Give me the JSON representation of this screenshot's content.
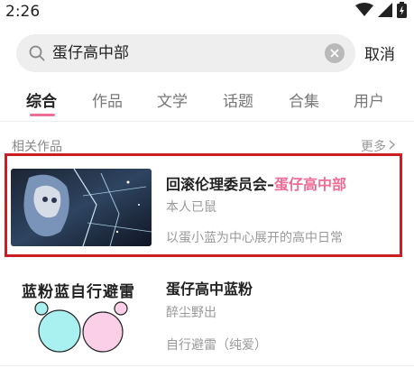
{
  "status_bar": {
    "time": "2:26"
  },
  "search": {
    "query": "蛋仔高中部",
    "cancel_label": "取消"
  },
  "tabs": [
    {
      "label": "综合",
      "active": true
    },
    {
      "label": "作品",
      "active": false
    },
    {
      "label": "文学",
      "active": false
    },
    {
      "label": "话题",
      "active": false
    },
    {
      "label": "合集",
      "active": false
    },
    {
      "label": "用户",
      "active": false
    }
  ],
  "section": {
    "title": "相关作品",
    "more_label": "更多"
  },
  "results": [
    {
      "title_prefix": "回滚伦理委员会–",
      "title_highlight": "蛋仔高中部",
      "author": "本人已鼠",
      "description": "以蛋小蓝为中心展开的高中日常"
    },
    {
      "title": "蛋仔高中蓝粉",
      "author": "醉尘野出",
      "description": "自行避雷（纯爱）",
      "cover_text": "蓝粉蓝自行避雷"
    }
  ],
  "colors": {
    "accent": "#ef6c95",
    "highlight_frame": "#cc1d22"
  }
}
